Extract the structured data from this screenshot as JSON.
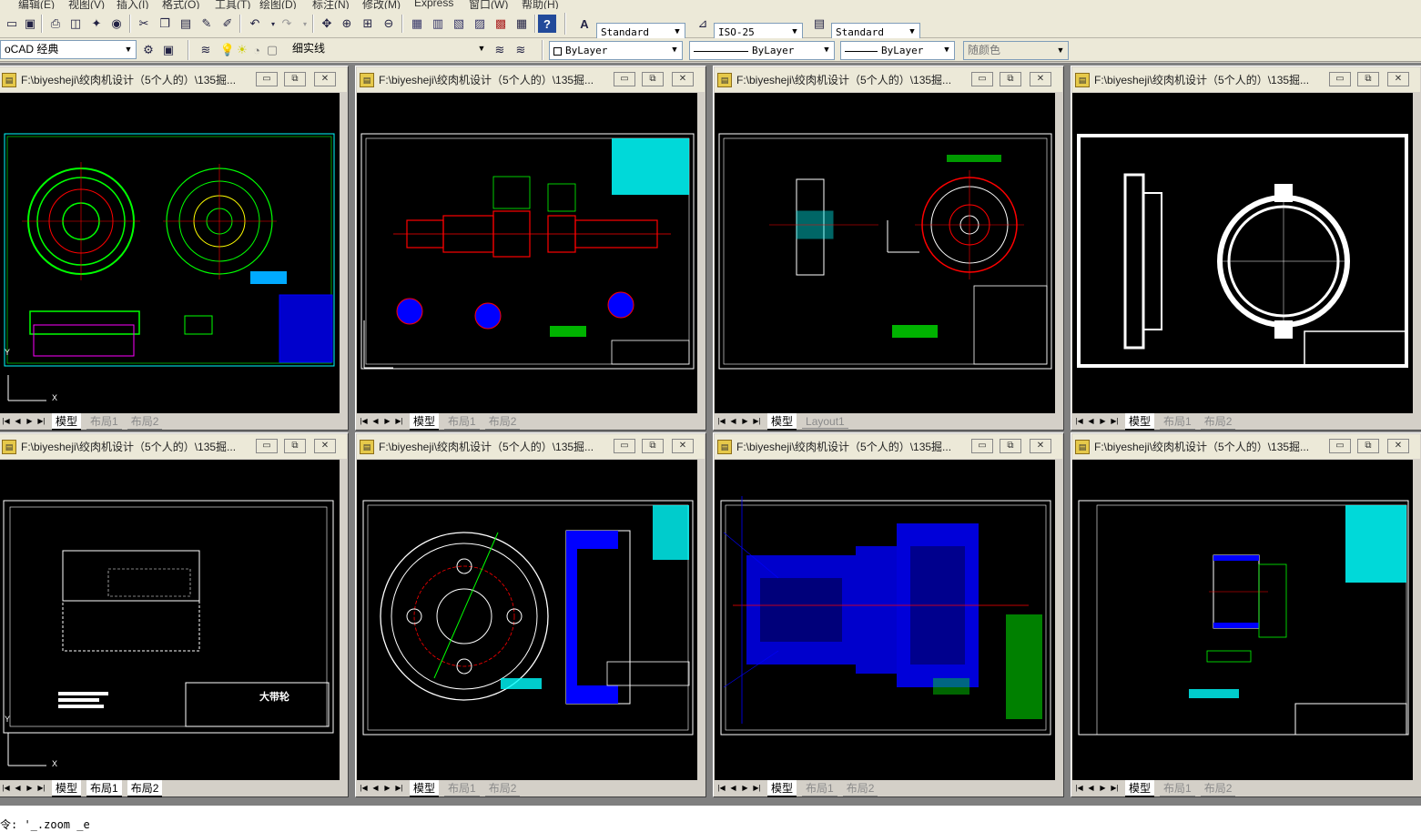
{
  "menubar": {
    "items": [
      "编辑(E)",
      "视图(V)",
      "插入(I)",
      "格式(O)",
      "工具(T)",
      "绘图(D)",
      "标注(N)",
      "修改(M)",
      "Express",
      "窗口(W)",
      "帮助(H)"
    ]
  },
  "toolbar1": {
    "text_style": "Standard",
    "dim_style": "ISO-25",
    "table_style": "Standard"
  },
  "toolbar2": {
    "workspace": "oCAD 经典",
    "layer": "细实线",
    "color": "ByLayer",
    "linetype": "ByLayer",
    "lineweight": "ByLayer",
    "plotstyle": "随颜色"
  },
  "windows": [
    {
      "title": "F:\\biyesheji\\绞肉机设计（5个人的）\\135掘...",
      "tabs": [
        "模型",
        "布局1",
        "布局2"
      ]
    },
    {
      "title": "F:\\biyesheji\\绞肉机设计（5个人的）\\135掘...",
      "tabs": [
        "模型",
        "布局1",
        "布局2"
      ]
    },
    {
      "title": "F:\\biyesheji\\绞肉机设计（5个人的）\\135掘...",
      "tabs": [
        "模型",
        "Layout1"
      ]
    },
    {
      "title": "F:\\biyesheji\\绞肉机设计（5个人的）\\135掘...",
      "tabs": [
        "模型",
        "布局1",
        "布局2"
      ]
    },
    {
      "title": "F:\\biyesheji\\绞肉机设计（5个人的）\\135掘...",
      "tabs": [
        "模型",
        "布局1",
        "布局2"
      ]
    },
    {
      "title": "F:\\biyesheji\\绞肉机设计（5个人的）\\135掘...",
      "tabs": [
        "模型",
        "布局1",
        "布局2"
      ]
    },
    {
      "title": "F:\\biyesheji\\绞肉机设计（5个人的）\\135掘...",
      "tabs": [
        "模型",
        "布局1",
        "布局2"
      ]
    },
    {
      "title": "F:\\biyesheji\\绞肉机设计（5个人的）\\135掘...",
      "tabs": [
        "模型",
        "布局1",
        "布局2"
      ]
    }
  ],
  "drawing_labels": {
    "wheel": "大带轮"
  },
  "ucs": {
    "x": "X",
    "y": "Y"
  },
  "command": {
    "text": "令: '_.zoom _e"
  },
  "colors": {
    "canvas": "#000000",
    "green": "#00ff00",
    "red": "#ff0000",
    "blue": "#0000ff",
    "cyan": "#00ffff",
    "white": "#ffffff"
  }
}
